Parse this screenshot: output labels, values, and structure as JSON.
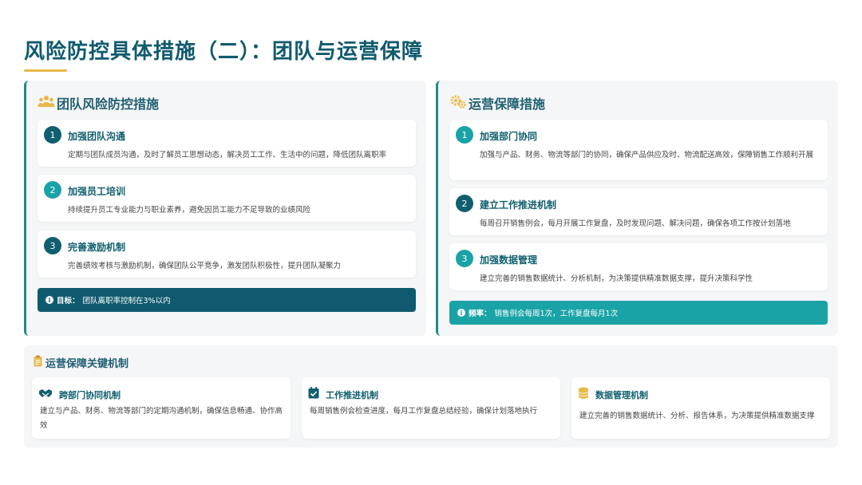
{
  "title": "风险防控具体措施（二）：团队与运营保障",
  "left": {
    "heading": "团队风险防控措施",
    "items": [
      {
        "num": "1",
        "title": "加强团队沟通",
        "desc": "定期与团队成员沟通，及时了解员工思想动态，解决员工工作、生活中的问题，降低团队离职率"
      },
      {
        "num": "2",
        "title": "加强员工培训",
        "desc": "持续提升员工专业能力与职业素养，避免因员工能力不足导致的业绩风险"
      },
      {
        "num": "3",
        "title": "完善激励机制",
        "desc": "完善绩效考核与激励机制，确保团队公平竞争，激发团队积极性，提升团队凝聚力"
      }
    ],
    "goal_label": "目标：",
    "goal_text": "团队离职率控制在3%以内"
  },
  "right": {
    "heading": "运营保障措施",
    "items": [
      {
        "num": "1",
        "title": "加强部门协同",
        "desc": "加强与产品、财务、物流等部门的协同，确保产品供应及时、物流配送高效，保障销售工作顺利开展"
      },
      {
        "num": "2",
        "title": "建立工作推进机制",
        "desc": "每周召开销售例会，每月开展工作复盘，及时发现问题、解决问题，确保各项工作按计划落地"
      },
      {
        "num": "3",
        "title": "加强数据管理",
        "desc": "建立完善的销售数据统计、分析机制，为决策提供精准数据支撑，提升决策科学性"
      }
    ],
    "freq_label": "频率：",
    "freq_text": "销售例会每周1次，工作复盘每月1次"
  },
  "bottom": {
    "heading": "运营保障关键机制",
    "mechanisms": [
      {
        "title": "跨部门协同机制",
        "desc": "建立与产品、财务、物流等部门的定期沟通机制，确保信息畅通、协作高效",
        "icon": "handshake-icon"
      },
      {
        "title": "工作推进机制",
        "desc": "每周销售例会检查进度，每月工作复盘总结经验，确保计划落地执行",
        "icon": "calendar-check-icon"
      },
      {
        "title": "数据管理机制",
        "desc": "建立完善的销售数据统计、分析、报告体系，为决策提供精准数据支撑",
        "icon": "database-icon"
      }
    ]
  },
  "colors": {
    "primary": "#0f5a6e",
    "teal": "#1aa3a6",
    "accent": "#e8b94a"
  }
}
